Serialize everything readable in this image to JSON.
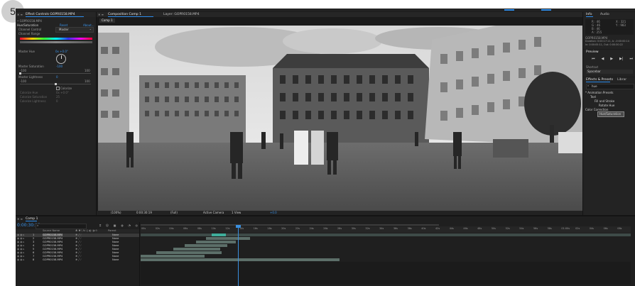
{
  "step_badge": "5",
  "effect_controls": {
    "tab_label": "Effect Controls GOPR0158.MP4",
    "source": "• GOPR0158.MP4",
    "effect_name": "Hue/Saturation",
    "reset_label": "Reset",
    "about_label": "About...",
    "channel_control_label": "Channel Control",
    "channel_control_value": "Master",
    "channel_range_label": "Channel Range",
    "master_hue_label": "Master Hue",
    "master_hue_value": "0x +0.0°",
    "master_saturation_label": "Master Saturation",
    "master_saturation_value": "-100",
    "sat_min": "-100",
    "sat_max": "100",
    "master_lightness_label": "Master Lightness",
    "master_lightness_value": "0",
    "light_min": "-100",
    "light_max": "100",
    "colorize_label": "Colorize",
    "colorize_hue_label": "Colorize Hue",
    "colorize_hue_value": "0x +0.0°",
    "colorize_saturation_label": "Colorize Saturation",
    "colorize_saturation_value": "25",
    "colorize_lightness_label": "Colorize Lightness",
    "colorize_lightness_value": "0"
  },
  "composition": {
    "tab_label": "Composition Comp 1",
    "layer_tab_label": "Layer: GOPR0158.MP4",
    "comp_name_tab": "Comp 1",
    "viewer_bar": {
      "zoom": "(100%)",
      "time": "0:00:30:19",
      "resolution": "(Full)",
      "camera": "Active Camera",
      "views": "1 View",
      "exposure": "+0.0"
    }
  },
  "info_panel": {
    "tab_info": "Info",
    "tab_audio": "Audio",
    "r": "R : 46",
    "g": "G : 46",
    "b": "B : 46",
    "a": "A : 255",
    "x": "X : 321",
    "y": "Y : 983",
    "layer_name": "GOPR0158.MP4",
    "duration": "Duration: 0:00:17:11, A: -0:00:00:14",
    "in_out": "In: 0:00:05:11, Out: 0:00:30:22"
  },
  "preview_panel": {
    "title": "Preview",
    "shortcut_label": "Shortcut",
    "shortcut_value": "Spacebar"
  },
  "effects_presets": {
    "title": "Effects & Presets",
    "tab_libraries": "Librar",
    "search_value": "hue",
    "tree": [
      "* Animation Presets",
      "Text",
      "Fill and Stroke",
      "Rotate Hue",
      "Color Correction",
      "Hue/Saturation"
    ]
  },
  "timeline": {
    "tab_label": "Comp 1",
    "timecode": "0:00:30:19",
    "column_source_name": "Source Name",
    "column_switches": "♣ ✱ \\ fx ◎ ◐ ◑ ⊙",
    "column_parent": "Parent",
    "layers": [
      {
        "num": "1",
        "name": "GOPR0158.MP4",
        "parent": "None"
      },
      {
        "num": "2",
        "name": "GOPR0158.MP4",
        "parent": "None"
      },
      {
        "num": "3",
        "name": "GOPR0158.MP4",
        "parent": "None"
      },
      {
        "num": "4",
        "name": "GOPR0158.MP4",
        "parent": "None"
      },
      {
        "num": "5",
        "name": "GOPR0158.MP4",
        "parent": "None"
      },
      {
        "num": "6",
        "name": "GOPR0158.MP4",
        "parent": "None"
      },
      {
        "num": "7",
        "name": "GOPR0158.MP4",
        "parent": "None"
      },
      {
        "num": "8",
        "name": "GOPR0158.MP4",
        "parent": "None"
      }
    ],
    "ruler_labels": [
      "00s",
      "02s",
      "04s",
      "06s",
      "08s",
      "10s",
      "12s",
      "14s",
      "16s",
      "18s",
      "20s",
      "22s",
      "24s",
      "26s",
      "28s",
      "30s",
      "32s",
      "34s",
      "36s",
      "38s",
      "40s",
      "42s",
      "44s",
      "46s",
      "48s",
      "50s",
      "52s",
      "54s",
      "56s",
      "58s",
      "01:00s",
      "02s",
      "04s",
      "06s",
      "08s"
    ]
  },
  "colors": {
    "accent_blue": "#2d8ceb",
    "selected_layer_bar": "#3fae9b",
    "layer_bar": "#5c6f69",
    "playhead": "#3a8fde"
  }
}
